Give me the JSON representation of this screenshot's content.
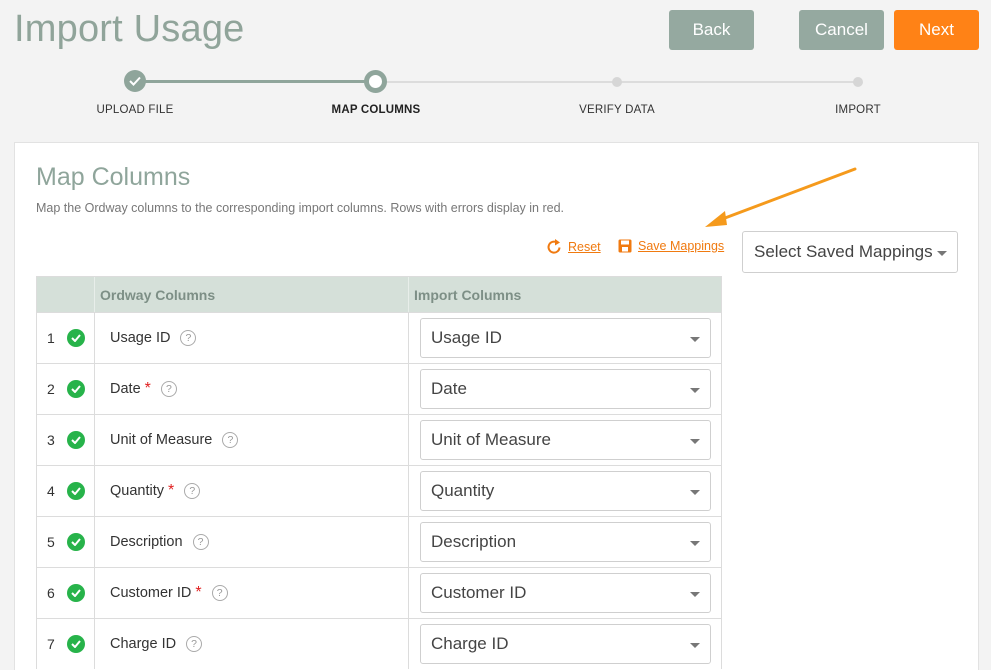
{
  "page": {
    "title": "Import Usage"
  },
  "header_buttons": {
    "back": "Back",
    "cancel": "Cancel",
    "next": "Next"
  },
  "stepper": {
    "steps": [
      {
        "label": "UPLOAD FILE",
        "state": "done"
      },
      {
        "label": "MAP COLUMNS",
        "state": "current"
      },
      {
        "label": "VERIFY DATA",
        "state": "todo"
      },
      {
        "label": "IMPORT",
        "state": "todo"
      }
    ]
  },
  "panel": {
    "title": "Map Columns",
    "description": "Map the Ordway columns to the corresponding import columns. Rows with errors display in red.",
    "reset_label": "Reset",
    "save_label": "Save Mappings",
    "saved_mappings_placeholder": "Select Saved Mappings"
  },
  "table": {
    "headers": {
      "ordway": "Ordway Columns",
      "import": "Import Columns"
    },
    "rows": [
      {
        "num": "1",
        "ordway": "Usage ID",
        "required": false,
        "import": "Usage ID"
      },
      {
        "num": "2",
        "ordway": "Date",
        "required": true,
        "import": "Date"
      },
      {
        "num": "3",
        "ordway": "Unit of Measure",
        "required": false,
        "import": "Unit of Measure"
      },
      {
        "num": "4",
        "ordway": "Quantity",
        "required": true,
        "import": "Quantity"
      },
      {
        "num": "5",
        "ordway": "Description",
        "required": false,
        "import": "Description"
      },
      {
        "num": "6",
        "ordway": "Customer ID",
        "required": true,
        "import": "Customer ID"
      },
      {
        "num": "7",
        "ordway": "Charge ID",
        "required": false,
        "import": "Charge ID"
      }
    ],
    "required_marker": "*",
    "help_glyph": "?"
  },
  "colors": {
    "accent": "#ff8216",
    "brand_gray": "#8fa59b",
    "success": "#27b34a",
    "required": "#e02020"
  }
}
